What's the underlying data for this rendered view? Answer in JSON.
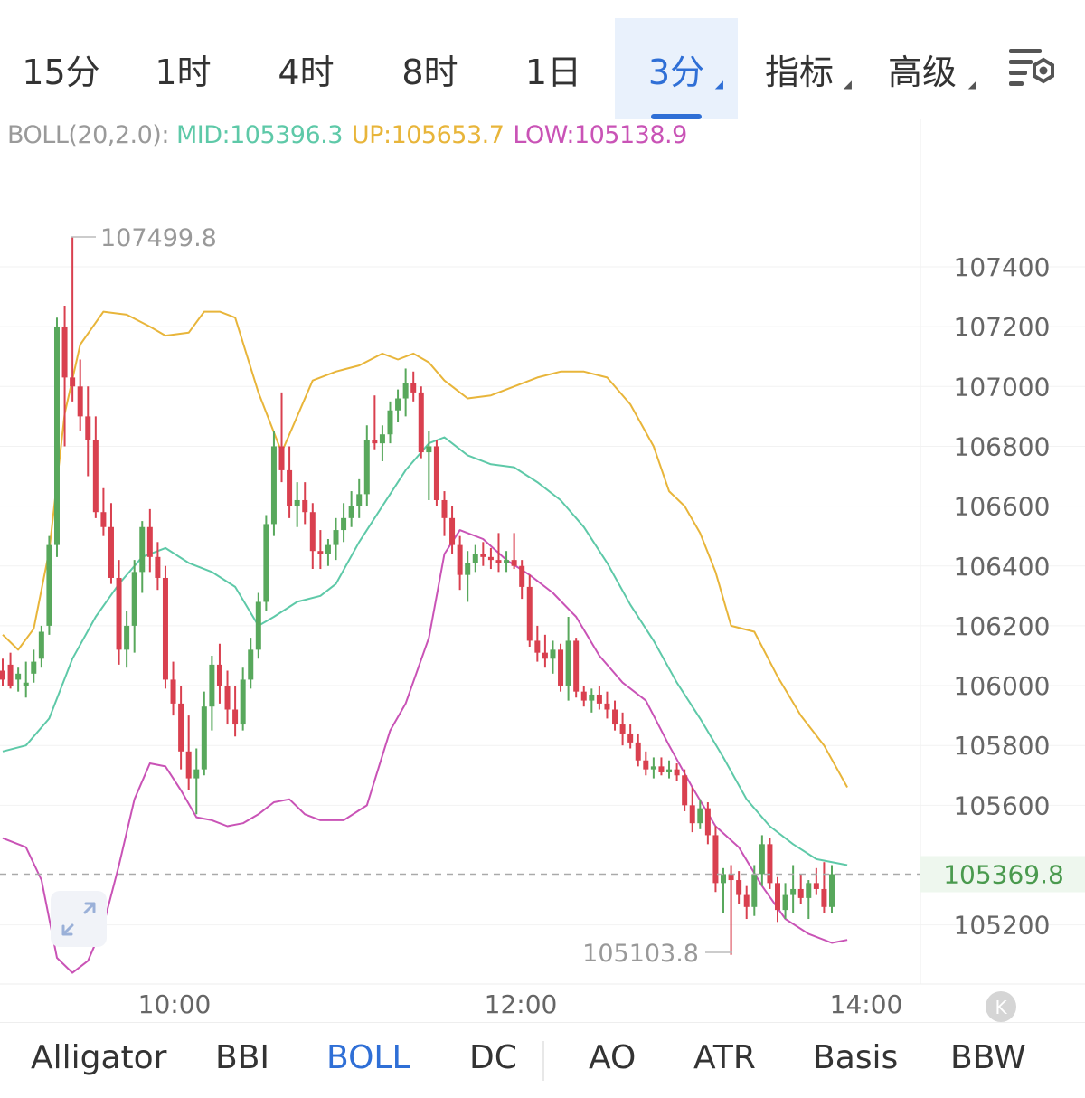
{
  "timeframes": {
    "items": [
      "15分",
      "1时",
      "4时",
      "8时",
      "1日"
    ],
    "active": "3分",
    "indicators_label": "指标",
    "advanced_label": "高级"
  },
  "legend": {
    "name": "BOLL(20,2.0):",
    "mid": "MID:105396.3",
    "up": "UP:105653.7",
    "low": "LOW:105138.9",
    "colors": {
      "name": "#9a9a9a",
      "mid": "#5ec9a8",
      "up": "#e8b53a",
      "low": "#c953b6"
    }
  },
  "price_axis": {
    "ticks": [
      "107400",
      "107200",
      "107000",
      "106800",
      "106600",
      "106400",
      "106200",
      "106000",
      "105800",
      "105600",
      "105200"
    ],
    "current_price": "105369.8"
  },
  "time_axis": {
    "ticks": [
      "10:00",
      "12:00",
      "14:00"
    ]
  },
  "annotations": {
    "high": "107499.8",
    "low": "105103.8"
  },
  "bottom_indicators": {
    "items": [
      "Alligator",
      "BBI",
      "BOLL",
      "DC",
      "AO",
      "ATR",
      "Basis",
      "BBW"
    ],
    "active": "BOLL"
  },
  "chart_data": {
    "type": "candlestick",
    "ylim": [
      104950,
      107950
    ],
    "x_ticks": [
      "10:00",
      "12:00",
      "14:00"
    ],
    "colors": {
      "up": "#58a85c",
      "down": "#d9404f",
      "mid": "#5ec9a8",
      "upper": "#e8b53a",
      "lower": "#c953b6"
    },
    "candles": [
      [
        106050,
        106090,
        106000,
        106020
      ],
      [
        106070,
        106110,
        105990,
        106000
      ],
      [
        106020,
        106060,
        105980,
        106040
      ],
      [
        106000,
        106080,
        105960,
        106010
      ],
      [
        106040,
        106120,
        106010,
        106080
      ],
      [
        106090,
        106200,
        106060,
        106180
      ],
      [
        106200,
        106500,
        106170,
        106470
      ],
      [
        106470,
        107230,
        106430,
        107200
      ],
      [
        107200,
        107270,
        106800,
        107030
      ],
      [
        107030,
        107500,
        106950,
        107000
      ],
      [
        107000,
        107090,
        106850,
        106900
      ],
      [
        106900,
        107000,
        106700,
        106820
      ],
      [
        106820,
        106900,
        106560,
        106580
      ],
      [
        106580,
        106660,
        106500,
        106530
      ],
      [
        106530,
        106610,
        106340,
        106360
      ],
      [
        106360,
        106420,
        106070,
        106120
      ],
      [
        106120,
        106250,
        106060,
        106200
      ],
      [
        106200,
        106420,
        106110,
        106380
      ],
      [
        106380,
        106550,
        106310,
        106530
      ],
      [
        106530,
        106590,
        106380,
        106430
      ],
      [
        106430,
        106480,
        106320,
        106360
      ],
      [
        106360,
        106400,
        105990,
        106020
      ],
      [
        106020,
        106080,
        105900,
        105940
      ],
      [
        105940,
        106000,
        105720,
        105780
      ],
      [
        105780,
        105900,
        105650,
        105690
      ],
      [
        105690,
        105790,
        105570,
        105720
      ],
      [
        105720,
        105980,
        105700,
        105930
      ],
      [
        105930,
        106100,
        105850,
        106070
      ],
      [
        106070,
        106140,
        105940,
        106000
      ],
      [
        106000,
        106050,
        105870,
        105920
      ],
      [
        105920,
        106000,
        105830,
        105870
      ],
      [
        105870,
        106060,
        105850,
        106020
      ],
      [
        106020,
        106160,
        105990,
        106120
      ],
      [
        106120,
        106310,
        106090,
        106280
      ],
      [
        106280,
        106570,
        106250,
        106540
      ],
      [
        106540,
        106850,
        106500,
        106800
      ],
      [
        106800,
        106980,
        106680,
        106720
      ],
      [
        106720,
        106800,
        106560,
        106600
      ],
      [
        106600,
        106680,
        106530,
        106620
      ],
      [
        106620,
        106680,
        106540,
        106580
      ],
      [
        106580,
        106610,
        106390,
        106450
      ],
      [
        106450,
        106520,
        106390,
        106440
      ],
      [
        106440,
        106490,
        106400,
        106470
      ],
      [
        106470,
        106560,
        106420,
        106520
      ],
      [
        106520,
        106610,
        106480,
        106560
      ],
      [
        106560,
        106650,
        106530,
        106600
      ],
      [
        106600,
        106690,
        106560,
        106640
      ],
      [
        106640,
        106870,
        106600,
        106820
      ],
      [
        106820,
        106970,
        106790,
        106810
      ],
      [
        106810,
        106870,
        106750,
        106840
      ],
      [
        106840,
        106950,
        106810,
        106920
      ],
      [
        106920,
        106990,
        106880,
        106960
      ],
      [
        106960,
        107060,
        106900,
        107010
      ],
      [
        107010,
        107050,
        106950,
        106980
      ],
      [
        106980,
        107000,
        106760,
        106780
      ],
      [
        106780,
        106850,
        106620,
        106800
      ],
      [
        106800,
        106820,
        106600,
        106620
      ],
      [
        106620,
        106650,
        106500,
        106560
      ],
      [
        106560,
        106600,
        106440,
        106470
      ],
      [
        106470,
        106500,
        106320,
        106370
      ],
      [
        106370,
        106450,
        106280,
        106410
      ],
      [
        106410,
        106470,
        106380,
        106440
      ],
      [
        106440,
        106480,
        106400,
        106430
      ],
      [
        106430,
        106460,
        106390,
        106420
      ],
      [
        106420,
        106510,
        106380,
        106410
      ],
      [
        106410,
        106450,
        106380,
        106420
      ],
      [
        106420,
        106510,
        106390,
        106400
      ],
      [
        106400,
        106420,
        106290,
        106330
      ],
      [
        106330,
        106370,
        106130,
        106150
      ],
      [
        106150,
        106200,
        106080,
        106110
      ],
      [
        106110,
        106170,
        106060,
        106090
      ],
      [
        106090,
        106150,
        106040,
        106120
      ],
      [
        106120,
        106140,
        105980,
        106000
      ],
      [
        106000,
        106230,
        105950,
        106150
      ],
      [
        106150,
        106160,
        105960,
        105980
      ],
      [
        105980,
        106000,
        105930,
        105950
      ],
      [
        105950,
        105990,
        105910,
        105970
      ],
      [
        105970,
        106000,
        105920,
        105940
      ],
      [
        105940,
        105980,
        105890,
        105920
      ],
      [
        105920,
        105950,
        105850,
        105870
      ],
      [
        105870,
        105910,
        105800,
        105840
      ],
      [
        105840,
        105870,
        105790,
        105810
      ],
      [
        105810,
        105840,
        105730,
        105750
      ],
      [
        105750,
        105780,
        105700,
        105720
      ],
      [
        105720,
        105760,
        105690,
        105730
      ],
      [
        105730,
        105760,
        105700,
        105710
      ],
      [
        105710,
        105750,
        105690,
        105720
      ],
      [
        105720,
        105740,
        105680,
        105700
      ],
      [
        105700,
        105720,
        105580,
        105600
      ],
      [
        105600,
        105660,
        105510,
        105540
      ],
      [
        105540,
        105620,
        105520,
        105590
      ],
      [
        105590,
        105610,
        105470,
        105500
      ],
      [
        105500,
        105530,
        105310,
        105340
      ],
      [
        105340,
        105390,
        105240,
        105370
      ],
      [
        105370,
        105400,
        105100,
        105350
      ],
      [
        105350,
        105380,
        105270,
        105300
      ],
      [
        105300,
        105330,
        105220,
        105260
      ],
      [
        105260,
        105400,
        105230,
        105370
      ],
      [
        105370,
        105500,
        105330,
        105470
      ],
      [
        105470,
        105490,
        105320,
        105340
      ],
      [
        105340,
        105360,
        105210,
        105250
      ],
      [
        105250,
        105340,
        105220,
        105300
      ],
      [
        105300,
        105400,
        105240,
        105320
      ],
      [
        105320,
        105370,
        105270,
        105290
      ],
      [
        105290,
        105350,
        105220,
        105340
      ],
      [
        105340,
        105390,
        105300,
        105320
      ],
      [
        105320,
        105410,
        105240,
        105260
      ],
      [
        105260,
        105400,
        105240,
        105369.8
      ]
    ],
    "upper": [
      [
        0,
        106170
      ],
      [
        2,
        106120
      ],
      [
        4,
        106190
      ],
      [
        6,
        106450
      ],
      [
        8,
        106910
      ],
      [
        10,
        107140
      ],
      [
        13,
        107250
      ],
      [
        16,
        107240
      ],
      [
        19,
        107200
      ],
      [
        21,
        107170
      ],
      [
        24,
        107180
      ],
      [
        26,
        107250
      ],
      [
        28,
        107250
      ],
      [
        30,
        107230
      ],
      [
        33,
        106980
      ],
      [
        36,
        106780
      ],
      [
        38,
        106900
      ],
      [
        40,
        107020
      ],
      [
        43,
        107050
      ],
      [
        46,
        107070
      ],
      [
        49,
        107110
      ],
      [
        51,
        107090
      ],
      [
        53,
        107110
      ],
      [
        55,
        107080
      ],
      [
        57,
        107020
      ],
      [
        60,
        106960
      ],
      [
        63,
        106970
      ],
      [
        66,
        107000
      ],
      [
        69,
        107030
      ],
      [
        72,
        107050
      ],
      [
        75,
        107050
      ],
      [
        78,
        107030
      ],
      [
        81,
        106940
      ],
      [
        84,
        106800
      ],
      [
        86,
        106650
      ],
      [
        88,
        106600
      ],
      [
        90,
        106510
      ],
      [
        92,
        106380
      ],
      [
        94,
        106200
      ],
      [
        97,
        106180
      ],
      [
        100,
        106030
      ],
      [
        103,
        105900
      ],
      [
        106,
        105800
      ],
      [
        109,
        105660
      ]
    ],
    "mid": [
      [
        0,
        105780
      ],
      [
        3,
        105800
      ],
      [
        6,
        105890
      ],
      [
        9,
        106090
      ],
      [
        12,
        106230
      ],
      [
        15,
        106340
      ],
      [
        18,
        106430
      ],
      [
        21,
        106460
      ],
      [
        24,
        106410
      ],
      [
        27,
        106380
      ],
      [
        30,
        106330
      ],
      [
        33,
        106200
      ],
      [
        35,
        106230
      ],
      [
        38,
        106280
      ],
      [
        41,
        106300
      ],
      [
        43,
        106340
      ],
      [
        46,
        106480
      ],
      [
        49,
        106600
      ],
      [
        52,
        106720
      ],
      [
        55,
        106810
      ],
      [
        57,
        106830
      ],
      [
        60,
        106770
      ],
      [
        63,
        106740
      ],
      [
        66,
        106730
      ],
      [
        69,
        106680
      ],
      [
        72,
        106620
      ],
      [
        75,
        106530
      ],
      [
        78,
        106410
      ],
      [
        81,
        106270
      ],
      [
        84,
        106150
      ],
      [
        87,
        106010
      ],
      [
        90,
        105890
      ],
      [
        93,
        105760
      ],
      [
        96,
        105620
      ],
      [
        99,
        105530
      ],
      [
        102,
        105470
      ],
      [
        105,
        105420
      ],
      [
        109,
        105400
      ]
    ],
    "lower": [
      [
        0,
        105490
      ],
      [
        3,
        105460
      ],
      [
        5,
        105350
      ],
      [
        7,
        105090
      ],
      [
        9,
        105040
      ],
      [
        11,
        105080
      ],
      [
        13,
        105200
      ],
      [
        15,
        105400
      ],
      [
        17,
        105620
      ],
      [
        19,
        105740
      ],
      [
        21,
        105730
      ],
      [
        23,
        105650
      ],
      [
        25,
        105560
      ],
      [
        27,
        105550
      ],
      [
        29,
        105530
      ],
      [
        31,
        105540
      ],
      [
        33,
        105570
      ],
      [
        35,
        105610
      ],
      [
        37,
        105620
      ],
      [
        39,
        105570
      ],
      [
        41,
        105550
      ],
      [
        44,
        105550
      ],
      [
        47,
        105600
      ],
      [
        50,
        105850
      ],
      [
        52,
        105940
      ],
      [
        55,
        106160
      ],
      [
        57,
        106440
      ],
      [
        59,
        106520
      ],
      [
        62,
        106490
      ],
      [
        65,
        106420
      ],
      [
        68,
        106370
      ],
      [
        71,
        106310
      ],
      [
        74,
        106230
      ],
      [
        77,
        106100
      ],
      [
        80,
        106010
      ],
      [
        83,
        105950
      ],
      [
        86,
        105800
      ],
      [
        89,
        105660
      ],
      [
        92,
        105530
      ],
      [
        95,
        105460
      ],
      [
        98,
        105330
      ],
      [
        101,
        105220
      ],
      [
        104,
        105170
      ],
      [
        107,
        105140
      ],
      [
        109,
        105150
      ]
    ]
  }
}
